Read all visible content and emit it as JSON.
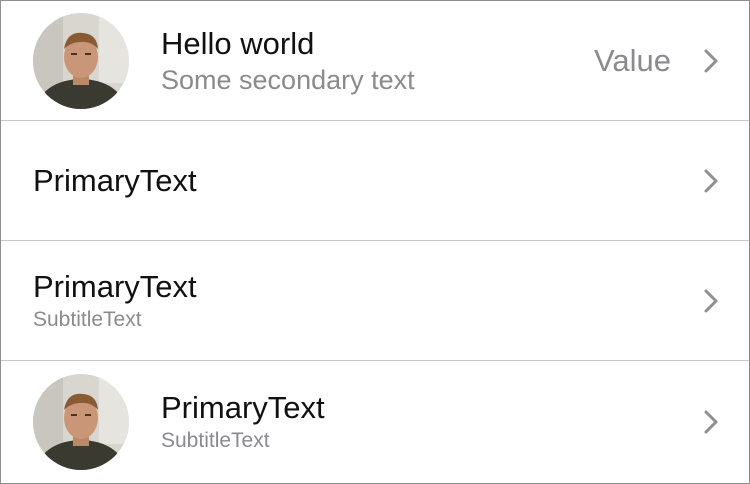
{
  "cells": [
    {
      "primary": "Hello world",
      "secondary": "Some secondary text",
      "value": "Value",
      "avatar_icon": "person-photo",
      "accessory_icon": "chevron-right-icon"
    },
    {
      "primary": "PrimaryText",
      "accessory_icon": "chevron-right-icon"
    },
    {
      "primary": "PrimaryText",
      "subtitle": "SubtitleText",
      "accessory_icon": "chevron-right-icon"
    },
    {
      "primary": "PrimaryText",
      "subtitle": "SubtitleText",
      "avatar_icon": "person-photo",
      "accessory_icon": "chevron-right-icon"
    }
  ],
  "colors": {
    "primary_text": "#111111",
    "secondary_text": "#8a8a8f",
    "separator": "#c8c7cc",
    "chevron": "#8e8e93"
  }
}
